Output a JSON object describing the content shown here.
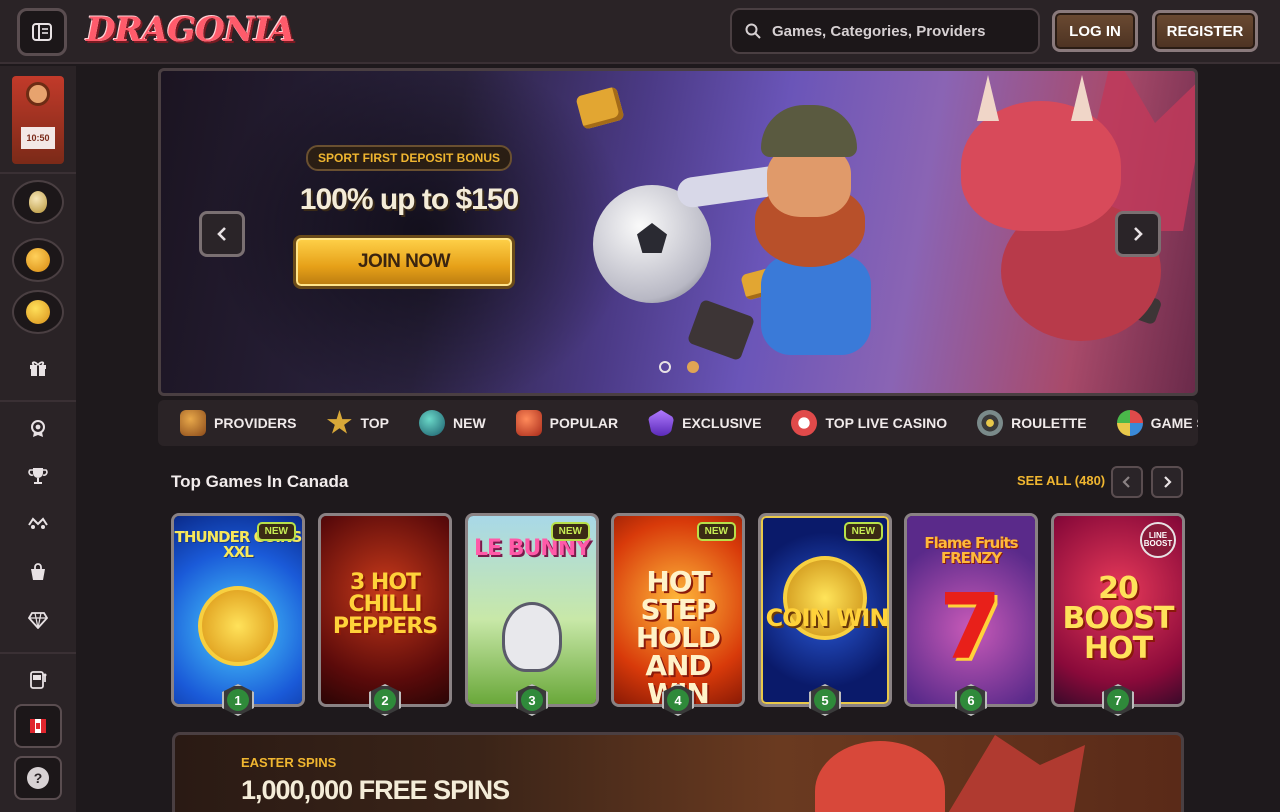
{
  "header": {
    "logo": "DRAGONIA",
    "search_placeholder": "Games, Categories, Providers",
    "login_label": "LOG IN",
    "register_label": "REGISTER"
  },
  "sidebar": {
    "promo_value": "10:50"
  },
  "banner": {
    "badge": "SPORT FIRST DEPOSIT BONUS",
    "offer": "100% up to $150",
    "cta": "JOIN NOW",
    "slide_count": 2,
    "active_slide": 2
  },
  "categories": [
    {
      "label": "PROVIDERS",
      "color": "#b8722a"
    },
    {
      "label": "TOP",
      "color": "#d8a838"
    },
    {
      "label": "NEW",
      "color": "#2a8a8a"
    },
    {
      "label": "POPULAR",
      "color": "#c84a2a"
    },
    {
      "label": "EXCLUSIVE",
      "color": "#8a4ad8"
    },
    {
      "label": "TOP LIVE CASINO",
      "color": "#e04a4a"
    },
    {
      "label": "ROULETTE",
      "color": "#7a8a8a"
    },
    {
      "label": "GAME SHOW",
      "color": "#3a8ad8"
    }
  ],
  "top_games": {
    "title": "Top Games In Canada",
    "see_all": "SEE ALL (480)",
    "games": [
      {
        "title": "THUNDER COINS XXL",
        "rank": "1",
        "new": "NEW"
      },
      {
        "title": "3 HOT CHILLI PEPPERS",
        "rank": "2"
      },
      {
        "title": "LE BUNNY",
        "rank": "3",
        "new": "NEW"
      },
      {
        "title": "HOT STEP HOLD AND WIN",
        "rank": "4",
        "new": "NEW"
      },
      {
        "title": "COIN WIN",
        "rank": "5",
        "new": "NEW"
      },
      {
        "title": "Flame Fruits FRENZY",
        "rank": "6"
      },
      {
        "title": "20 BOOST HOT",
        "rank": "7",
        "badge": "LINE BOOST"
      }
    ]
  },
  "easter": {
    "subtitle": "EASTER SPINS",
    "title": "1,000,000 FREE SPINS"
  }
}
